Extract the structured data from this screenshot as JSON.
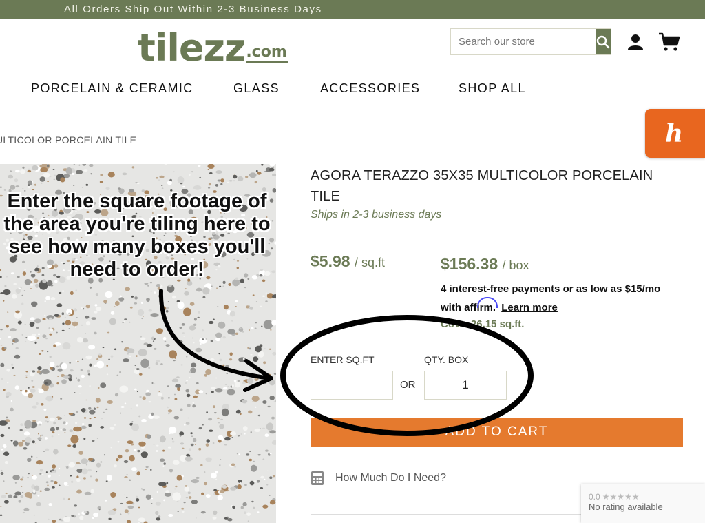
{
  "announcement": "All Orders Ship Out Within 2-3 Business Days",
  "logo": {
    "main": "tilezz",
    "suffix": ".com"
  },
  "search": {
    "placeholder": "Search our store"
  },
  "icons": {
    "search": "search-icon",
    "account": "account-icon",
    "cart": "cart-icon",
    "honey": "honey-icon",
    "calculator": "calculator-icon"
  },
  "nav": {
    "items": [
      "PORCELAIN & CERAMIC",
      "GLASS",
      "ACCESSORIES",
      "SHOP ALL"
    ]
  },
  "honey": {
    "glyph": "h"
  },
  "breadcrumb": "ULTICOLOR PORCELAIN TILE",
  "callout": "Enter the square footage of the area you're tiling here to see how many boxes you'll need to order!",
  "product": {
    "title": "AGORA TERAZZO 35X35 MULTICOLOR PORCELAIN TILE",
    "shipping": "Ships in 2-3 business days",
    "price_sqft": "$5.98",
    "price_sqft_unit": "/ sq.ft",
    "price_box": "$156.38",
    "price_box_unit": "/ box",
    "installments_line": "4 interest-free payments or as low as $15/mo",
    "installments_with": "with",
    "affirm": "affirm",
    "installments_period": ".",
    "learn_more": "Learn more",
    "coverage": "Cov... 26.15 sq.ft."
  },
  "calculator": {
    "sqft_label": "ENTER SQ.FT",
    "sqft_value": "",
    "or_label": "OR",
    "qty_label": "QTY. BOX",
    "qty_value": "1"
  },
  "add_to_cart": "ADD TO CART",
  "how_much": "How Much Do I Need?",
  "rating": {
    "score": "0.0",
    "stars": "★★★★★",
    "text": "No rating available"
  },
  "colors": {
    "brand_green": "#6b7a55",
    "cart_orange": "#e57a2e",
    "honey_orange": "#e8661f"
  }
}
